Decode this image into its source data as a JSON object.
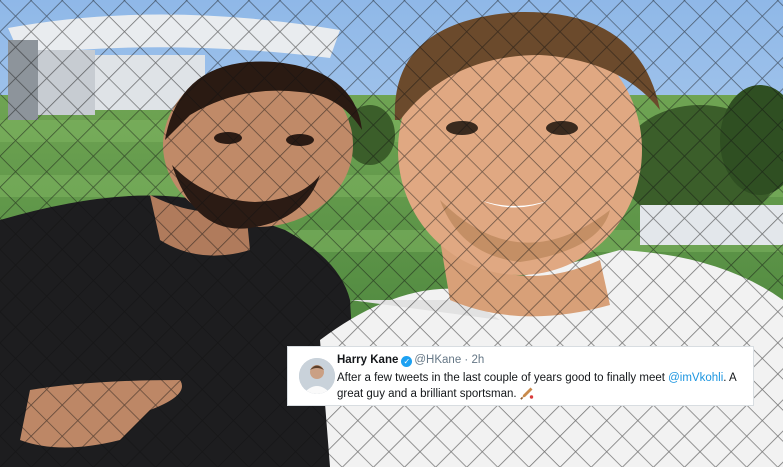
{
  "tweet": {
    "name": "Harry Kane",
    "handle": "@HKane",
    "separator": "·",
    "time": "2h",
    "verified_icon": "check-badge-icon",
    "text_before": "After a few tweets in the last couple of years good to finally meet ",
    "mention": "@imVkohli",
    "text_after": ". A great guy and a brilliant sportsman.",
    "emoji_icon": "cricket-bat-icon"
  },
  "colors": {
    "verified": "#1da1f2",
    "mention": "#1b95e0",
    "handle": "#657786"
  }
}
